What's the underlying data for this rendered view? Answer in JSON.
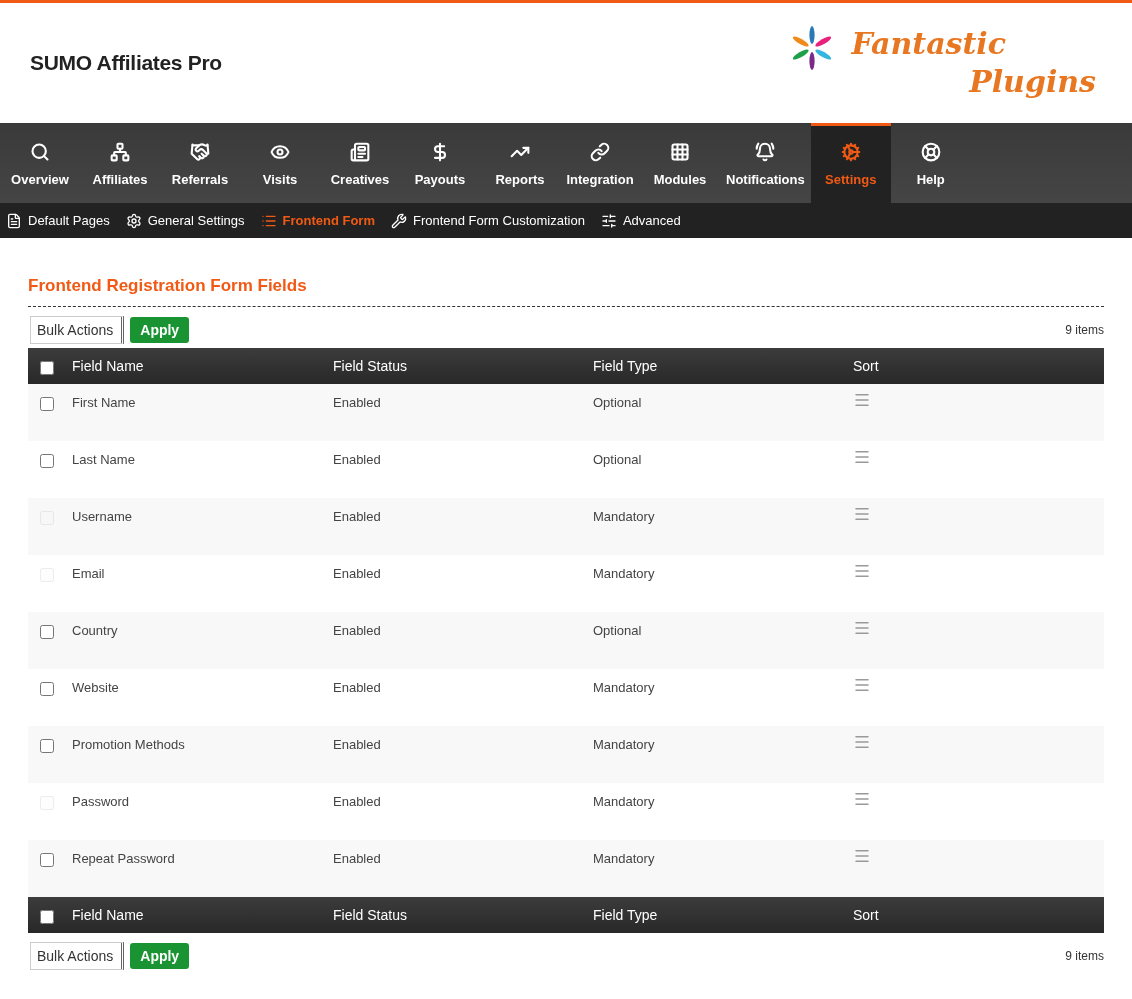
{
  "header": {
    "title": "SUMO Affiliates Pro",
    "logo_lines": [
      "Fantastic",
      "Plugins"
    ]
  },
  "nav": [
    {
      "label": "Overview",
      "selected": false
    },
    {
      "label": "Affiliates",
      "selected": false
    },
    {
      "label": "Referrals",
      "selected": false
    },
    {
      "label": "Visits",
      "selected": false
    },
    {
      "label": "Creatives",
      "selected": false
    },
    {
      "label": "Payouts",
      "selected": false
    },
    {
      "label": "Reports",
      "selected": false
    },
    {
      "label": "Integration",
      "selected": false
    },
    {
      "label": "Modules",
      "selected": false
    },
    {
      "label": "Notifications",
      "selected": false
    },
    {
      "label": "Settings",
      "selected": true
    },
    {
      "label": "Help",
      "selected": false
    }
  ],
  "subnav": [
    {
      "label": "Default Pages",
      "selected": false
    },
    {
      "label": "General Settings",
      "selected": false
    },
    {
      "label": "Frontend Form",
      "selected": true
    },
    {
      "label": "Frontend Form Customization",
      "selected": false
    },
    {
      "label": "Advanced",
      "selected": false
    }
  ],
  "section_title": "Frontend Registration Form Fields",
  "top_toolbar": {
    "bulk_actions": "Bulk Actions",
    "apply": "Apply",
    "count": "9 items"
  },
  "table": {
    "select_all_checked": false,
    "footer_select_all_checked": false,
    "columns": [
      "Field Name",
      "Field Status",
      "Field Type",
      "Sort"
    ],
    "rows": [
      {
        "name": "First Name",
        "status": "Enabled",
        "type": "Optional",
        "disabled": false
      },
      {
        "name": "Last Name",
        "status": "Enabled",
        "type": "Optional",
        "disabled": false
      },
      {
        "name": "Username",
        "status": "Enabled",
        "type": "Mandatory",
        "disabled": true
      },
      {
        "name": "Email",
        "status": "Enabled",
        "type": "Mandatory",
        "disabled": true
      },
      {
        "name": "Country",
        "status": "Enabled",
        "type": "Optional",
        "disabled": false
      },
      {
        "name": "Website",
        "status": "Enabled",
        "type": "Mandatory",
        "disabled": false
      },
      {
        "name": "Promotion Methods",
        "status": "Enabled",
        "type": "Mandatory",
        "disabled": false
      },
      {
        "name": "Password",
        "status": "Enabled",
        "type": "Mandatory",
        "disabled": true
      },
      {
        "name": "Repeat Password",
        "status": "Enabled",
        "type": "Mandatory",
        "disabled": false
      }
    ],
    "footer_columns": [
      "Field Name",
      "Field Status",
      "Field Type",
      "Sort"
    ]
  },
  "bottom_toolbar": {
    "bulk_actions": "Bulk Actions",
    "apply": "Apply",
    "count": "9 items"
  }
}
